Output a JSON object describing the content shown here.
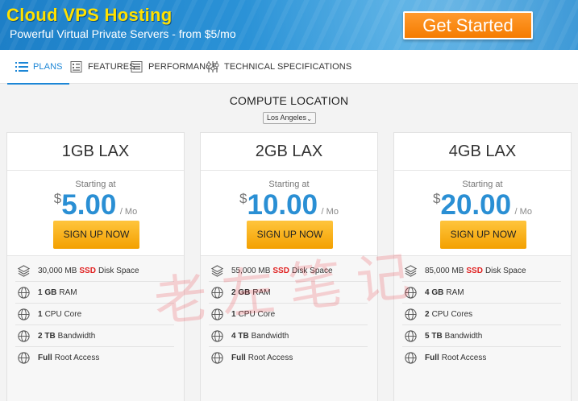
{
  "hero": {
    "title": "Cloud VPS Hosting",
    "subtitle": "Powerful Virtual Private Servers - from $5/mo",
    "cta_label": "Get Started"
  },
  "tabs": [
    {
      "label": "PLANS",
      "icon": "list-icon",
      "active": true
    },
    {
      "label": "FEATURES",
      "icon": "features-icon",
      "active": false
    },
    {
      "label": "PERFORMANCE",
      "icon": "performance-icon",
      "active": false
    },
    {
      "label": "TECHNICAL SPECIFICATIONS",
      "icon": "sliders-icon",
      "active": false
    }
  ],
  "location": {
    "title": "COMPUTE LOCATION",
    "selected": "Los Angeles"
  },
  "plans": [
    {
      "name": "1GB LAX",
      "starting": "Starting at",
      "currency": "$",
      "price": "5.00",
      "period": "/ Mo",
      "signup": "SIGN UP NOW",
      "features": [
        {
          "pre": "30,000 MB",
          "hl": "SSD",
          "post": "Disk Space",
          "icon": "layers-icon"
        },
        {
          "pre": "1 GB",
          "post": "RAM",
          "icon": "globe-icon"
        },
        {
          "pre": "1",
          "post": "CPU Core",
          "icon": "globe-icon"
        },
        {
          "pre": "2 TB",
          "post": "Bandwidth",
          "icon": "globe-icon"
        },
        {
          "pre": "Full",
          "post": "Root Access",
          "icon": "globe-icon"
        }
      ]
    },
    {
      "name": "2GB LAX",
      "starting": "Starting at",
      "currency": "$",
      "price": "10.00",
      "period": "/ Mo",
      "signup": "SIGN UP NOW",
      "features": [
        {
          "pre": "55,000 MB",
          "hl": "SSD",
          "post": "Disk Space",
          "icon": "layers-icon"
        },
        {
          "pre": "2 GB",
          "post": "RAM",
          "icon": "globe-icon"
        },
        {
          "pre": "1",
          "post": "CPU Core",
          "icon": "globe-icon"
        },
        {
          "pre": "4 TB",
          "post": "Bandwidth",
          "icon": "globe-icon"
        },
        {
          "pre": "Full",
          "post": "Root Access",
          "icon": "globe-icon"
        }
      ]
    },
    {
      "name": "4GB LAX",
      "starting": "Starting at",
      "currency": "$",
      "price": "20.00",
      "period": "/ Mo",
      "signup": "SIGN UP NOW",
      "features": [
        {
          "pre": "85,000 MB",
          "hl": "SSD",
          "post": "Disk Space",
          "icon": "layers-icon"
        },
        {
          "pre": "4 GB",
          "post": "RAM",
          "icon": "globe-icon"
        },
        {
          "pre": "2",
          "post": "CPU Cores",
          "icon": "globe-icon"
        },
        {
          "pre": "5 TB",
          "post": "Bandwidth",
          "icon": "globe-icon"
        },
        {
          "pre": "Full",
          "post": "Root Access",
          "icon": "globe-icon"
        }
      ]
    }
  ],
  "watermark": "老左笔记",
  "colors": {
    "accent": "#1c86d6",
    "cta": "#f57c00",
    "signup": "#f3a000",
    "ssd": "#e02020",
    "title": "#ffe100"
  }
}
